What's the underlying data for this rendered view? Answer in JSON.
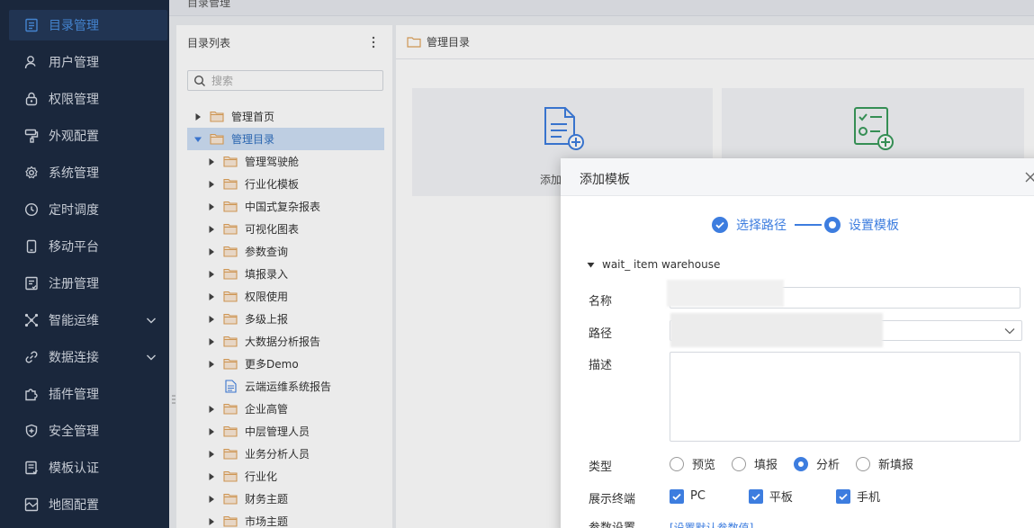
{
  "topbar": {
    "title": "目录管理"
  },
  "sidebar": {
    "items": [
      {
        "label": "目录管理",
        "icon": "catalog-icon",
        "active": true
      },
      {
        "label": "用户管理",
        "icon": "user-icon"
      },
      {
        "label": "权限管理",
        "icon": "lock-icon"
      },
      {
        "label": "外观配置",
        "icon": "paint-roller-icon"
      },
      {
        "label": "系统管理",
        "icon": "gear-icon"
      },
      {
        "label": "定时调度",
        "icon": "clock-icon"
      },
      {
        "label": "移动平台",
        "icon": "mobile-icon"
      },
      {
        "label": "注册管理",
        "icon": "register-icon"
      },
      {
        "label": "智能运维",
        "icon": "network-icon",
        "expandable": true
      },
      {
        "label": "数据连接",
        "icon": "link-icon",
        "expandable": true
      },
      {
        "label": "插件管理",
        "icon": "puzzle-icon"
      },
      {
        "label": "安全管理",
        "icon": "shield-icon"
      },
      {
        "label": "模板认证",
        "icon": "template-cert-icon"
      },
      {
        "label": "地图配置",
        "icon": "map-icon"
      }
    ]
  },
  "list_panel": {
    "title": "目录列表",
    "search_placeholder": "搜索",
    "tree": [
      {
        "label": "管理首页",
        "level": 0,
        "type": "folder",
        "expanded": false
      },
      {
        "label": "管理目录",
        "level": 0,
        "type": "folder",
        "expanded": true,
        "selected": true
      },
      {
        "label": "管理驾驶舱",
        "level": 1,
        "type": "folder"
      },
      {
        "label": "行业化模板",
        "level": 1,
        "type": "folder"
      },
      {
        "label": "中国式复杂报表",
        "level": 1,
        "type": "folder"
      },
      {
        "label": "可视化图表",
        "level": 1,
        "type": "folder"
      },
      {
        "label": "参数查询",
        "level": 1,
        "type": "folder"
      },
      {
        "label": "填报录入",
        "level": 1,
        "type": "folder"
      },
      {
        "label": "权限使用",
        "level": 1,
        "type": "folder"
      },
      {
        "label": "多级上报",
        "level": 1,
        "type": "folder"
      },
      {
        "label": "大数据分析报告",
        "level": 1,
        "type": "folder"
      },
      {
        "label": "更多Demo",
        "level": 1,
        "type": "folder"
      },
      {
        "label": "云端运维系统报告",
        "level": 1,
        "type": "document"
      },
      {
        "label": "企业高管",
        "level": 1,
        "type": "folder"
      },
      {
        "label": "中层管理人员",
        "level": 1,
        "type": "folder"
      },
      {
        "label": "业务分析人员",
        "level": 1,
        "type": "folder"
      },
      {
        "label": "行业化",
        "level": 1,
        "type": "folder"
      },
      {
        "label": "财务主题",
        "level": 1,
        "type": "folder"
      },
      {
        "label": "市场主题",
        "level": 1,
        "type": "folder"
      }
    ]
  },
  "right_panel": {
    "breadcrumb": "管理目录",
    "cards": [
      {
        "label": "添加",
        "icon": "add-document-icon"
      },
      {
        "label": "",
        "icon": "add-checklist-icon"
      }
    ]
  },
  "dialog": {
    "title": "添加模板",
    "steps": [
      "选择路径",
      "设置模板"
    ],
    "group": "wait_ item  warehouse",
    "fields": {
      "name_label": "名称",
      "path_label": "路径",
      "desc_label": "描述",
      "type_label": "类型",
      "terminal_label": "展示终端",
      "param_label": "参数设置"
    },
    "type_options": [
      {
        "label": "预览",
        "checked": false
      },
      {
        "label": "填报",
        "checked": false
      },
      {
        "label": "分析",
        "checked": true
      },
      {
        "label": "新填报",
        "checked": false
      }
    ],
    "terminals": [
      {
        "label": "PC",
        "checked": true
      },
      {
        "label": "平板",
        "checked": true
      },
      {
        "label": "手机",
        "checked": true
      }
    ],
    "param_link": "[设置默认参数值]"
  },
  "colors": {
    "accent": "#3d7ddf",
    "sidebar_bg": "#1d2b42",
    "folder": "#e0a35c"
  }
}
